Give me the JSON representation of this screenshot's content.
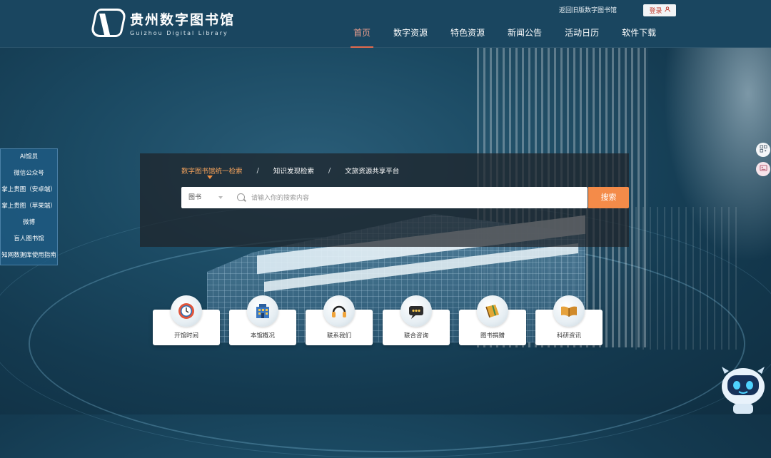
{
  "header": {
    "logo_cn": "贵州数字图书馆",
    "logo_en": "Guizhou Digital Library",
    "old_site_link": "返回旧版数字图书馆",
    "login_label": "登录",
    "nav": [
      {
        "label": "首页",
        "active": true
      },
      {
        "label": "数字资源",
        "active": false
      },
      {
        "label": "特色资源",
        "active": false
      },
      {
        "label": "新闻公告",
        "active": false
      },
      {
        "label": "活动日历",
        "active": false
      },
      {
        "label": "软件下载",
        "active": false
      }
    ]
  },
  "sidebar": {
    "items": [
      {
        "label": "AI馆员"
      },
      {
        "label": "微信公众号"
      },
      {
        "label": "掌上贵图（安卓端）"
      },
      {
        "label": "掌上贵图（苹果端）"
      },
      {
        "label": "微博"
      },
      {
        "label": "盲人图书馆"
      },
      {
        "label": "知网数据库使用指南"
      }
    ]
  },
  "search": {
    "tabs": [
      {
        "label": "数字图书馆统一检索",
        "active": true
      },
      {
        "label": "知识发现检索",
        "active": false
      },
      {
        "label": "文旅资源共享平台",
        "active": false
      }
    ],
    "separator": "/",
    "scope": "图书",
    "placeholder": "请输入你的搜索内容",
    "button_label": "搜索"
  },
  "services": [
    {
      "label": "开馆时间",
      "icon": "clock-icon"
    },
    {
      "label": "本馆概况",
      "icon": "building-icon"
    },
    {
      "label": "联系我们",
      "icon": "headset-icon"
    },
    {
      "label": "联合咨询",
      "icon": "chat-bubble-icon"
    },
    {
      "label": "图书捐赠",
      "icon": "book-gift-icon"
    },
    {
      "label": "科研资讯",
      "icon": "open-book-icon"
    }
  ],
  "colors": {
    "accent": "#f48b49",
    "nav_active": "#e46a4d",
    "header_bg": "#1a4660"
  }
}
